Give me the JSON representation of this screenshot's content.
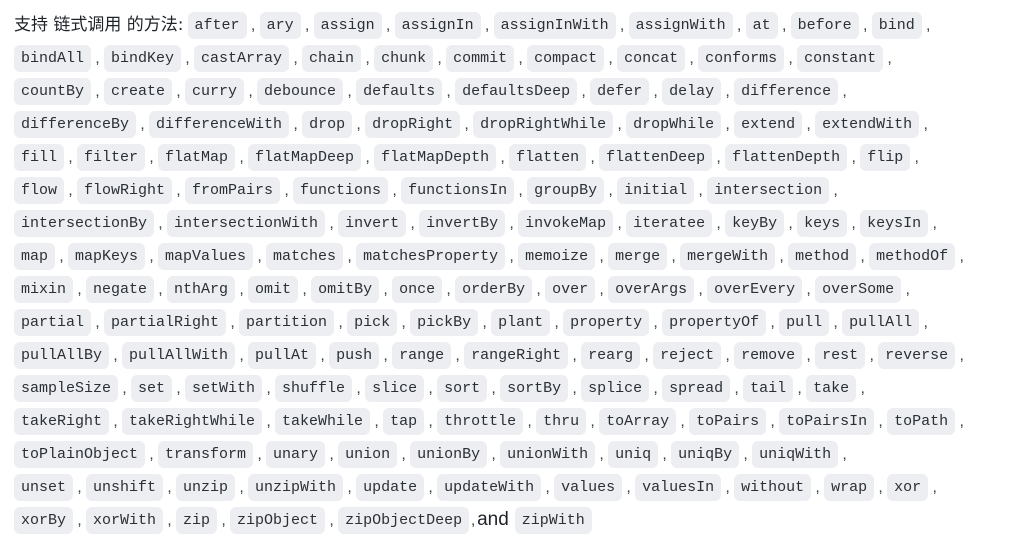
{
  "intro": "支持 链式调用 的方法:",
  "conjunction": "and",
  "lines": [
    [
      "after",
      "ary",
      "assign",
      "assignIn",
      "assignInWith",
      "assignWith",
      "at",
      "before",
      "bind"
    ],
    [
      "bindAll",
      "bindKey",
      "castArray",
      "chain",
      "chunk",
      "commit",
      "compact",
      "concat",
      "conforms",
      "constant"
    ],
    [
      "countBy",
      "create",
      "curry",
      "debounce",
      "defaults",
      "defaultsDeep",
      "defer",
      "delay",
      "difference"
    ],
    [
      "differenceBy",
      "differenceWith",
      "drop",
      "dropRight",
      "dropRightWhile",
      "dropWhile",
      "extend",
      "extendWith"
    ],
    [
      "fill",
      "filter",
      "flatMap",
      "flatMapDeep",
      "flatMapDepth",
      "flatten",
      "flattenDeep",
      "flattenDepth",
      "flip"
    ],
    [
      "flow",
      "flowRight",
      "fromPairs",
      "functions",
      "functionsIn",
      "groupBy",
      "initial",
      "intersection"
    ],
    [
      "intersectionBy",
      "intersectionWith",
      "invert",
      "invertBy",
      "invokeMap",
      "iteratee",
      "keyBy",
      "keys",
      "keysIn"
    ],
    [
      "map",
      "mapKeys",
      "mapValues",
      "matches",
      "matchesProperty",
      "memoize",
      "merge",
      "mergeWith",
      "method",
      "methodOf"
    ],
    [
      "mixin",
      "negate",
      "nthArg",
      "omit",
      "omitBy",
      "once",
      "orderBy",
      "over",
      "overArgs",
      "overEvery",
      "overSome"
    ],
    [
      "partial",
      "partialRight",
      "partition",
      "pick",
      "pickBy",
      "plant",
      "property",
      "propertyOf",
      "pull",
      "pullAll"
    ],
    [
      "pullAllBy",
      "pullAllWith",
      "pullAt",
      "push",
      "range",
      "rangeRight",
      "rearg",
      "reject",
      "remove",
      "rest",
      "reverse"
    ],
    [
      "sampleSize",
      "set",
      "setWith",
      "shuffle",
      "slice",
      "sort",
      "sortBy",
      "splice",
      "spread",
      "tail",
      "take"
    ],
    [
      "takeRight",
      "takeRightWhile",
      "takeWhile",
      "tap",
      "throttle",
      "thru",
      "toArray",
      "toPairs",
      "toPairsIn",
      "toPath"
    ],
    [
      "toPlainObject",
      "transform",
      "unary",
      "union",
      "unionBy",
      "unionWith",
      "uniq",
      "uniqBy",
      "uniqWith"
    ],
    [
      "unset",
      "unshift",
      "unzip",
      "unzipWith",
      "update",
      "updateWith",
      "values",
      "valuesIn",
      "without",
      "wrap",
      "xor"
    ],
    [
      "xorBy",
      "xorWith",
      "zip",
      "zipObject",
      "zipObjectDeep",
      "zipWith"
    ]
  ]
}
